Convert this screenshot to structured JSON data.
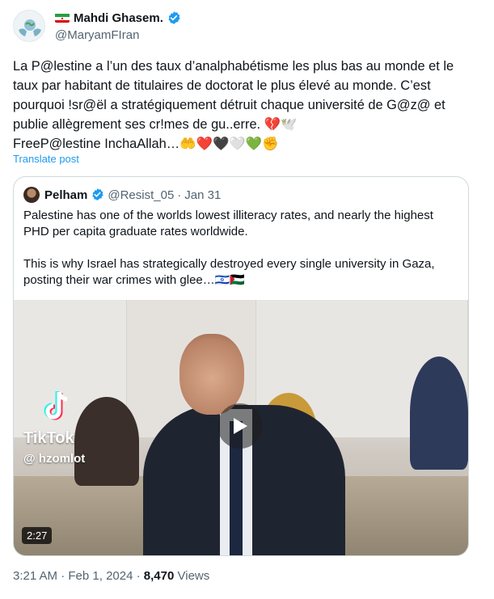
{
  "author": {
    "display_name": "Mahdi Ghasem.",
    "handle": "@MaryamFIran",
    "avatar_icon": "globe-hands-icon",
    "verified_icon": "verified-badge-icon",
    "flag_icon": "iran-flag-icon",
    "verified_color": "#1d9bf0"
  },
  "tweet": {
    "text": "La P@lestine a l’un des taux d’analphabétisme les plus bas au monde et le taux par habitant de titulaires de doctorat le plus élevé au monde. C’est pourquoi !sr@ël a stratégiquement détruit chaque université de G@z@ et publie allègrement ses cr!mes de gu..erre. 💔🕊️\nFreeP@lestine InchaAllah…🤲❤️🖤🤍💚✊",
    "translate_label": "Translate post"
  },
  "quote": {
    "display_name": "Pelham",
    "handle": "@Resist_05",
    "separator": "·",
    "date": "Jan 31",
    "text": "Palestine has one of the worlds lowest illiteracy rates, and nearly the highest PHD per capita graduate rates worldwide.\n\nThis is why Israel has strategically destroyed every single university in Gaza, posting their war crimes with glee…🇮🇱🇵🇸",
    "media": {
      "watermark_brand": "TikTok",
      "watermark_user": "@ hzomlot",
      "duration": "2:27",
      "play_icon": "play-icon"
    }
  },
  "footer": {
    "time": "3:21 AM",
    "sep1": "·",
    "date": "Feb 1, 2024",
    "sep2": "·",
    "views_count": "8,470",
    "views_label": "Views"
  },
  "colors": {
    "link_blue": "#1d9bf0",
    "secondary_text": "#536471",
    "primary_text": "#0f1419",
    "border": "#cfd9de"
  }
}
